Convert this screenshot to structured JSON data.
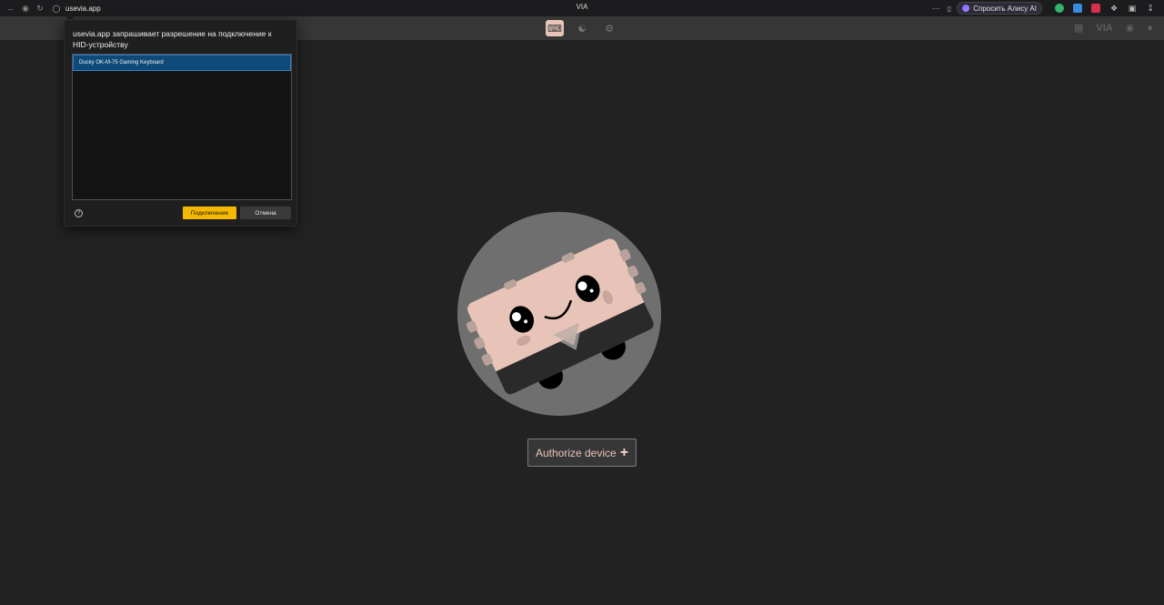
{
  "browser": {
    "url": "usevia.app",
    "title": "VIA",
    "alice_label": "Спросить Алису AI",
    "more_label": "···"
  },
  "dialog": {
    "title": "usevia.app запрашивает разрешение на подключение к HID-устройству",
    "devices": [
      "Ducky OK-M-75  Gaming Keyboard"
    ],
    "help_label": "?",
    "connect_label": "Подключение",
    "cancel_label": "Отмена"
  },
  "header": {
    "right_logo": "VIA"
  },
  "main": {
    "authorize_label": "Authorize device",
    "authorize_plus": "+"
  },
  "colors": {
    "accent": "#e8c4b8",
    "connect_button": "#f5b800",
    "selected_item": "#0d4a7a"
  }
}
